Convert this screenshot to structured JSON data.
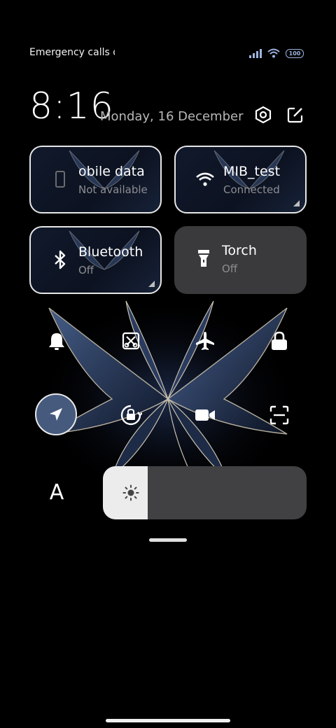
{
  "status_bar": {
    "left_text": "Emergency calls o",
    "battery": "100",
    "signal_bars": 4,
    "icons": [
      "signal-icon",
      "wifi-icon",
      "battery-icon"
    ]
  },
  "header": {
    "time": "8:16",
    "date": "Monday, 16 December",
    "buttons": [
      "settings-icon",
      "edit-icon"
    ]
  },
  "tiles": [
    {
      "id": "mobile-data",
      "label": "obile data",
      "status": "Not available",
      "icon": "mobile-data-icon"
    },
    {
      "id": "wifi",
      "label": "MIB_test",
      "status": "Connected",
      "icon": "wifi-icon"
    },
    {
      "id": "bluetooth",
      "label": "Bluetooth",
      "status": "Off",
      "icon": "bluetooth-icon"
    },
    {
      "id": "torch",
      "label": "Torch",
      "status": "Off",
      "icon": "torch-icon"
    }
  ],
  "toggles": [
    {
      "id": "sound",
      "icon": "bell-icon",
      "active": false
    },
    {
      "id": "screenshot",
      "icon": "screenshot-icon",
      "active": false
    },
    {
      "id": "airplane",
      "icon": "airplane-icon",
      "active": false
    },
    {
      "id": "lock",
      "icon": "lock-icon",
      "active": false
    },
    {
      "id": "location",
      "icon": "location-icon",
      "active": true
    },
    {
      "id": "rotation",
      "icon": "rotation-lock-icon",
      "active": false
    },
    {
      "id": "video",
      "icon": "video-icon",
      "active": false
    },
    {
      "id": "scanner",
      "icon": "scan-icon",
      "active": false
    }
  ],
  "brightness": {
    "auto_label": "A",
    "level": 0.22,
    "icon": "sun-icon"
  },
  "colors": {
    "background": "#000000",
    "tile_solid": "#3a3a3c",
    "active_toggle": "#465a7e",
    "accent_blue": "#9fb3e0",
    "subtext": "#8d8d92"
  }
}
